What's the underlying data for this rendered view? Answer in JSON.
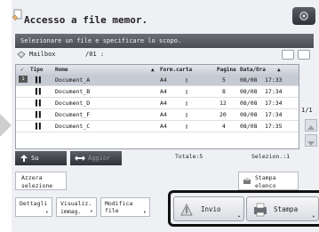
{
  "window": {
    "title": "Accesso a file memor.",
    "close_icon": "x-close-icon"
  },
  "instruction": "Selezionare un file e specificare lo scopo.",
  "mailbox": {
    "label": "Mailbox",
    "path": "/01 :"
  },
  "table": {
    "headers": {
      "check": "✓",
      "tipo": "Tipo",
      "nome": "Nome",
      "form": "Form.carta",
      "pagina": "Pagina",
      "data": "Data/Ora"
    },
    "rows": [
      {
        "nome": "Document_A",
        "form": "A4",
        "pagina": "5",
        "data": "08/08",
        "ora": "17:33",
        "selected": true
      },
      {
        "nome": "Document_B",
        "form": "A4",
        "pagina": "8",
        "data": "08/08",
        "ora": "17:34",
        "selected": false
      },
      {
        "nome": "Document_D",
        "form": "A4",
        "pagina": "12",
        "data": "08/08",
        "ora": "17:34",
        "selected": false
      },
      {
        "nome": "Document_F",
        "form": "A4",
        "pagina": "20",
        "data": "08/08",
        "ora": "17:34",
        "selected": false
      },
      {
        "nome": "Document_C",
        "form": "A4",
        "pagina": "4",
        "data": "08/08",
        "ora": "17:35",
        "selected": false
      }
    ]
  },
  "pagination": {
    "indicator": "1/1"
  },
  "nav": {
    "up": "Su",
    "back": "Aggior"
  },
  "totals": {
    "total": "Totale:5",
    "selected": "Selezion.:1"
  },
  "actions": {
    "azzera": "Azzera selezione",
    "stampa_elenco": "Stampa elenco",
    "dettagli": "Dettagli",
    "visualizza": "Visualiz. immag.",
    "modifica": "Modifica file",
    "invio": "Invio",
    "stampa": "Stampa"
  }
}
